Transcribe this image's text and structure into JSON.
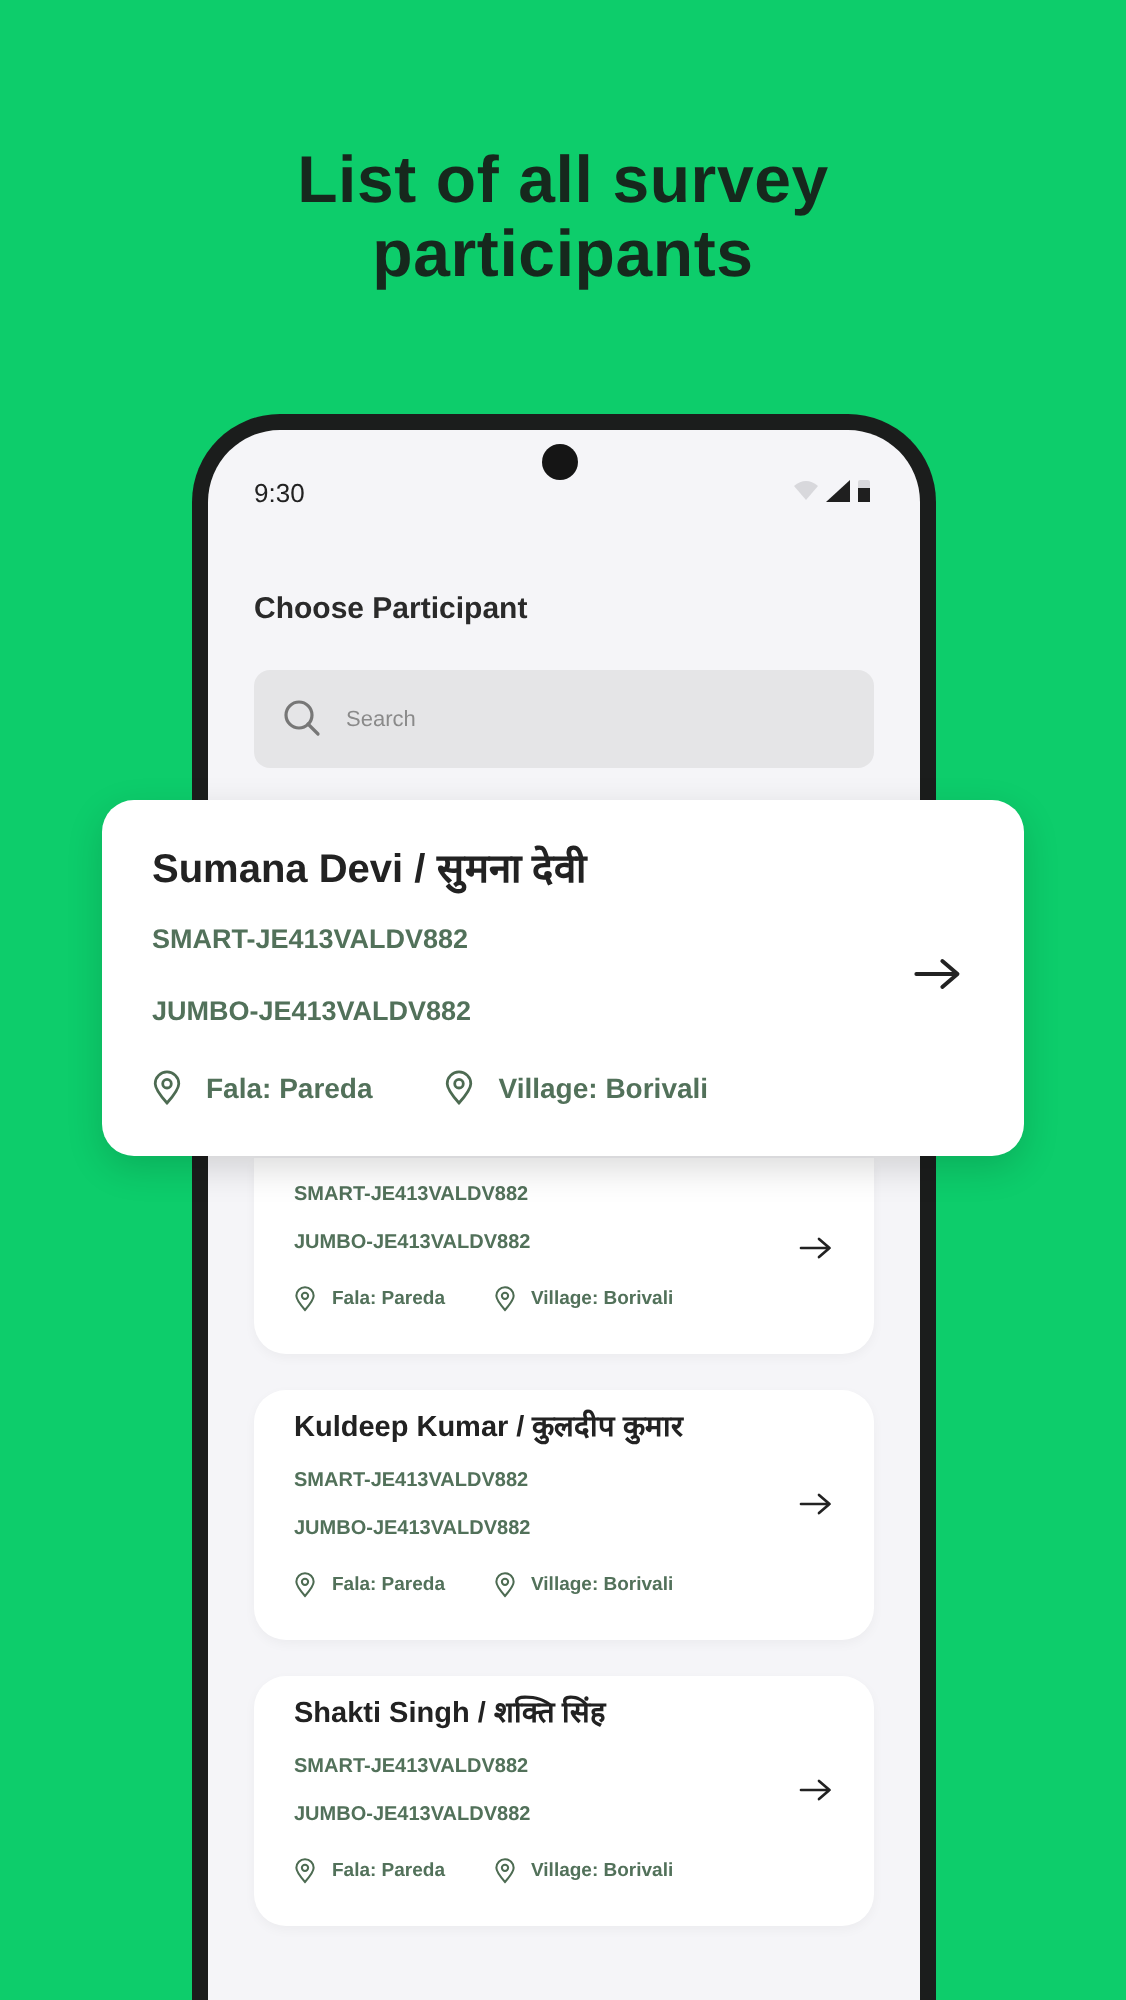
{
  "headline": "List of all survey participants",
  "status_bar": {
    "time": "9:30"
  },
  "screen_title": "Choose Participant",
  "search": {
    "placeholder": "Search"
  },
  "highlighted_participant": {
    "name": "Sumana Devi / सुमना देवी",
    "smart_id": "SMART-JE413VALDV882",
    "jumbo_id": "JUMBO-JE413VALDV882",
    "fala": "Fala: Pareda",
    "village": "Village: Borivali"
  },
  "participants": [
    {
      "smart_id": "SMART-JE413VALDV882",
      "jumbo_id": "JUMBO-JE413VALDV882",
      "fala": "Fala: Pareda",
      "village": "Village: Borivali"
    },
    {
      "name": "Kuldeep Kumar / कुलदीप कुमार",
      "smart_id": "SMART-JE413VALDV882",
      "jumbo_id": "JUMBO-JE413VALDV882",
      "fala": "Fala: Pareda",
      "village": "Village: Borivali"
    },
    {
      "name": "Shakti Singh / शक्ति सिंह",
      "smart_id": "SMART-JE413VALDV882",
      "jumbo_id": "JUMBO-JE413VALDV882",
      "fala": "Fala: Pareda",
      "village": "Village: Borivali"
    }
  ]
}
